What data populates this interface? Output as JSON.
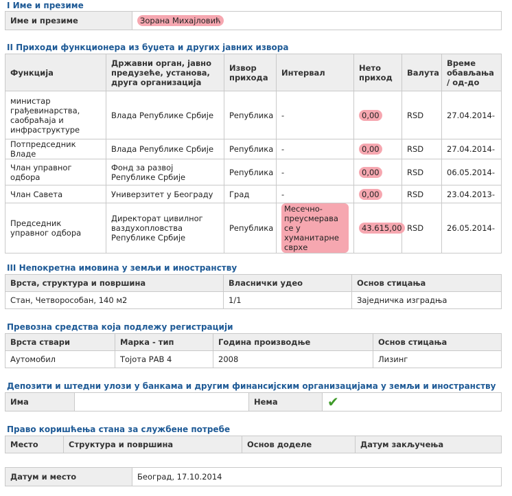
{
  "s1": {
    "title": "I Име и презиме",
    "label": "Име и презиме",
    "value": "Зорана Михајловић"
  },
  "s2": {
    "title": "II Приходи функционера из буџета и других јавних извора",
    "headers": [
      "Функција",
      "Државни орган, јавно предузеће, установа, друга организација",
      "Извор прихода",
      "Интервал",
      "Нето приход",
      "Валута",
      "Време обављања / од-до"
    ],
    "rows": [
      {
        "func": "министар грађевинарства, саобраћаја и инфраструктуре",
        "org": "Влада Републике Србије",
        "src": "Република",
        "int": "-",
        "net": "0,00",
        "cur": "RSD",
        "time": "27.04.2014-"
      },
      {
        "func": "Потпредседник Владе",
        "org": "Влада Републике Србије",
        "src": "Република",
        "int": "-",
        "net": "0,00",
        "cur": "RSD",
        "time": "27.04.2014-"
      },
      {
        "func": "Члан управног одбора",
        "org": "Фонд за развој Републике Србије",
        "src": "Република",
        "int": "-",
        "net": "0,00",
        "cur": "RSD",
        "time": "06.05.2014-"
      },
      {
        "func": "Члан Савета",
        "org": "Универзитет у Београду",
        "src": "Град",
        "int": "-",
        "net": "0,00",
        "cur": "RSD",
        "time": "23.04.2013-"
      },
      {
        "func": "Председник управног одбора",
        "org": "Директорат цивилног ваздухопловства Републике Србије",
        "src": "Република",
        "int": "Месечно-преусмерава се у хуманитарне сврхе",
        "net": "43.615,00",
        "cur": "RSD",
        "time": "26.05.2014-"
      }
    ]
  },
  "s3": {
    "title": "III Непокретна имовина у земљи и иностранству",
    "headers": [
      "Врста, структура и површина",
      "Власнички удео",
      "Основ стицања"
    ],
    "row": [
      "Стан, Четворособан, 140 м2",
      "1/1",
      "Заједничка изградња"
    ]
  },
  "s4": {
    "title": "Превозна средства која подлежу регистрацији",
    "headers": [
      "Врста ствари",
      "Марка - тип",
      "Година производње",
      "Основ стицања"
    ],
    "row": [
      "Аутомобил",
      "Тојота РАВ 4",
      "2008",
      "Лизинг"
    ]
  },
  "s5": {
    "title": "Депозити и штедни улози у банкама и другим финансијским организацијама у земљи и иностранству",
    "has": "Има",
    "none": "Нема",
    "check": "✔"
  },
  "s6": {
    "title": "Право коришћења стана за службене потребе",
    "headers": [
      "Место",
      "Структура и површина",
      "Основ доделе",
      "Датум закључења"
    ]
  },
  "s7": {
    "label": "Датум и место",
    "value": "Београд, 17.10.2014"
  }
}
